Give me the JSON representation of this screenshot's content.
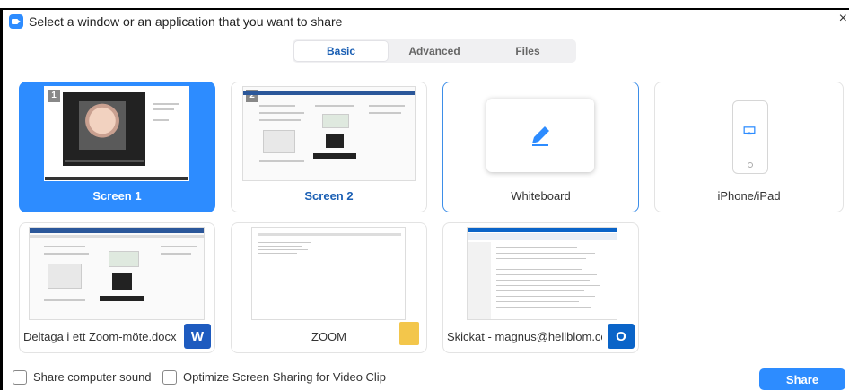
{
  "dialog": {
    "title": "Select a window or an application that you want to share",
    "close_glyph": "×",
    "app_icon": "zoom-camera-icon"
  },
  "tabs": [
    {
      "label": "Basic",
      "active": true
    },
    {
      "label": "Advanced",
      "active": false
    },
    {
      "label": "Files",
      "active": false
    }
  ],
  "cards": [
    {
      "label": "Screen 1",
      "screen_number": "1",
      "selected": true
    },
    {
      "label": "Screen 2",
      "screen_number": "2",
      "selected": false
    },
    {
      "label": "Whiteboard",
      "icon": "pen-icon",
      "selected": false
    },
    {
      "label": "iPhone/iPad",
      "icon": "airplay-icon",
      "selected": false
    },
    {
      "label": "Deltaga i ett Zoom-möte.docx - ...",
      "badge": "W",
      "app": "word-icon",
      "selected": false
    },
    {
      "label": "ZOOM",
      "app": "folder-icon",
      "selected": false
    },
    {
      "label": "Skickat - magnus@hellblom.com...",
      "badge": "O",
      "app": "outlook-icon",
      "selected": false
    }
  ],
  "options": {
    "share_sound": {
      "label": "Share computer sound",
      "checked": false
    },
    "optimize_video": {
      "label": "Optimize Screen Sharing for Video Clip",
      "checked": false
    }
  },
  "share_button": "Share",
  "colors": {
    "accent": "#2d8cff",
    "word": "#1e5bbf",
    "outlook": "#0a64c8",
    "folder": "#f3c64b"
  }
}
